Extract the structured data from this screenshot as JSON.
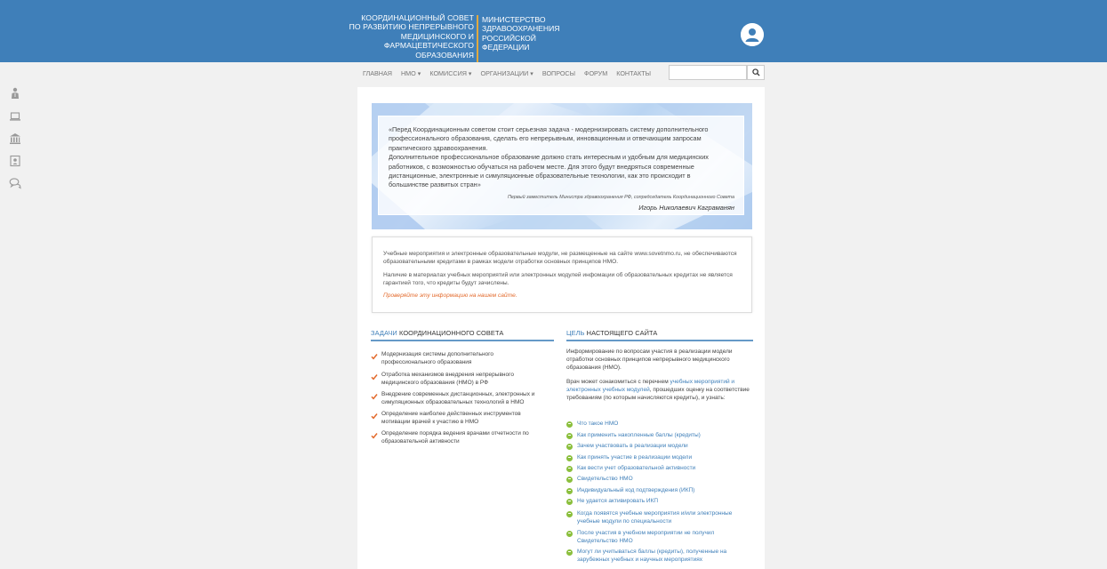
{
  "header": {
    "council_lines": [
      "КООРДИНАЦИОННЫЙ СОВЕТ",
      "ПО РАЗВИТИЮ НЕПРЕРЫВНОГО",
      "МЕДИЦИНСКОГО И",
      "ФАРМАЦЕВТИЧЕСКОГО",
      "ОБРАЗОВАНИЯ"
    ],
    "ministry_lines": [
      "МИНИСТЕРСТВО",
      "ЗДРАВООХРАНЕНИЯ",
      "РОССИЙСКОЙ",
      "ФЕДЕРАЦИИ"
    ],
    "accent_color": "#e2a93e",
    "brand_color": "#3f7fb9"
  },
  "nav": {
    "items": [
      "ГЛАВНАЯ",
      "НМО ▾",
      "КОМИССИЯ ▾",
      "ОРГАНИЗАЦИИ ▾",
      "ВОПРОСЫ",
      "ФОРУМ",
      "КОНТАКТЫ"
    ],
    "search_placeholder": ""
  },
  "sidebar": {
    "icons": [
      "doctor-icon",
      "laptop-icon",
      "institution-icon",
      "certificate-icon",
      "chat-icon"
    ]
  },
  "quote": {
    "text_lines": [
      "«Перед Координационным советом стоит серьезная задача - модернизировать систему дополнительного",
      "профессионального образования, сделать его непрерывным, инновационным и отвечающим запросам",
      "практического здравоохранения.",
      "Дополнительное профессиональное образование должно стать интересным и удобным для медицинских",
      "работников, с возможностью обучаться на рабочем месте. Для этого будут внедряться современные",
      "дистанционные, электронные и симуляционные образовательные технологии, как это происходит в",
      "большинстве развитых стран»"
    ],
    "author_role": "Первый заместитель Министра здравоохранения РФ, сопредседатель Координационного Совета",
    "author_name": "Игорь Николаевич Каграманян"
  },
  "notice": {
    "p1": "Учебные мероприятия и электронные образовательные модули, не размещенные на сайте www.sovetnmo.ru, не обеспечиваются образовательными кредитами в рамках модели отработки основных принципов НМО.",
    "p2": "Наличие в материалах учебных мероприятий или электронных модулей инфомации об образовательных кредитах не является гарантией того, что кредиты будут зачислены.",
    "p3": "Проверяйте эту информацию на нашем сайте."
  },
  "tasks": {
    "title_accent": "ЗАДАЧИ",
    "title_rest": " КООРДИНАЦИОННОГО СОВЕТА",
    "items": [
      "Модернизация системы дополнительного профессионального образования",
      "Отработка механизмов внедрения непрерывного медицинского образования (НМО) в РФ",
      "Внедрение современных дистанционных, электронных и симуляционных образовательных технологий в НМО",
      "Определение наиболее действенных инструментов мотивации врачей к участию в НМО",
      "Определение порядка ведения врачами отчетности по образовательной активности"
    ]
  },
  "goal": {
    "title_accent": "ЦЕЛЬ",
    "title_rest": " НАСТОЯЩЕГО САЙТА",
    "intro": "Информирование по вопросам участия в реализации модели отработки основных принципов непрерывного медицинского образования (НМО).",
    "doctor_pre": "Врач может ознакомиться с перечнем ",
    "doctor_link": "учебных мероприятий и электронных учебных модулей",
    "doctor_post": ", прошедших оценку на соответствие требованиям (по которым начисляются кредиты), и узнать:",
    "links": [
      "Что такое НМО",
      "Как применить накопленные баллы (кредиты)",
      "Зачем участвовать в реализации модели",
      "Как принять участие в реализации модели",
      "Как вести учет образовательной активности",
      "Свидетельство НМО",
      "Индивидуальный код подтверждения (ИКП)",
      "Не удается активировать ИКП",
      "Когда появятся учебные мероприятия и/или электронные учебные модули по специальности",
      "После участия в учебном мероприятии не получил Свидетельство НМО",
      "Могут ли учитываться баллы (кредиты), полученные на зарубежных учебных и научных мероприятиях"
    ]
  }
}
